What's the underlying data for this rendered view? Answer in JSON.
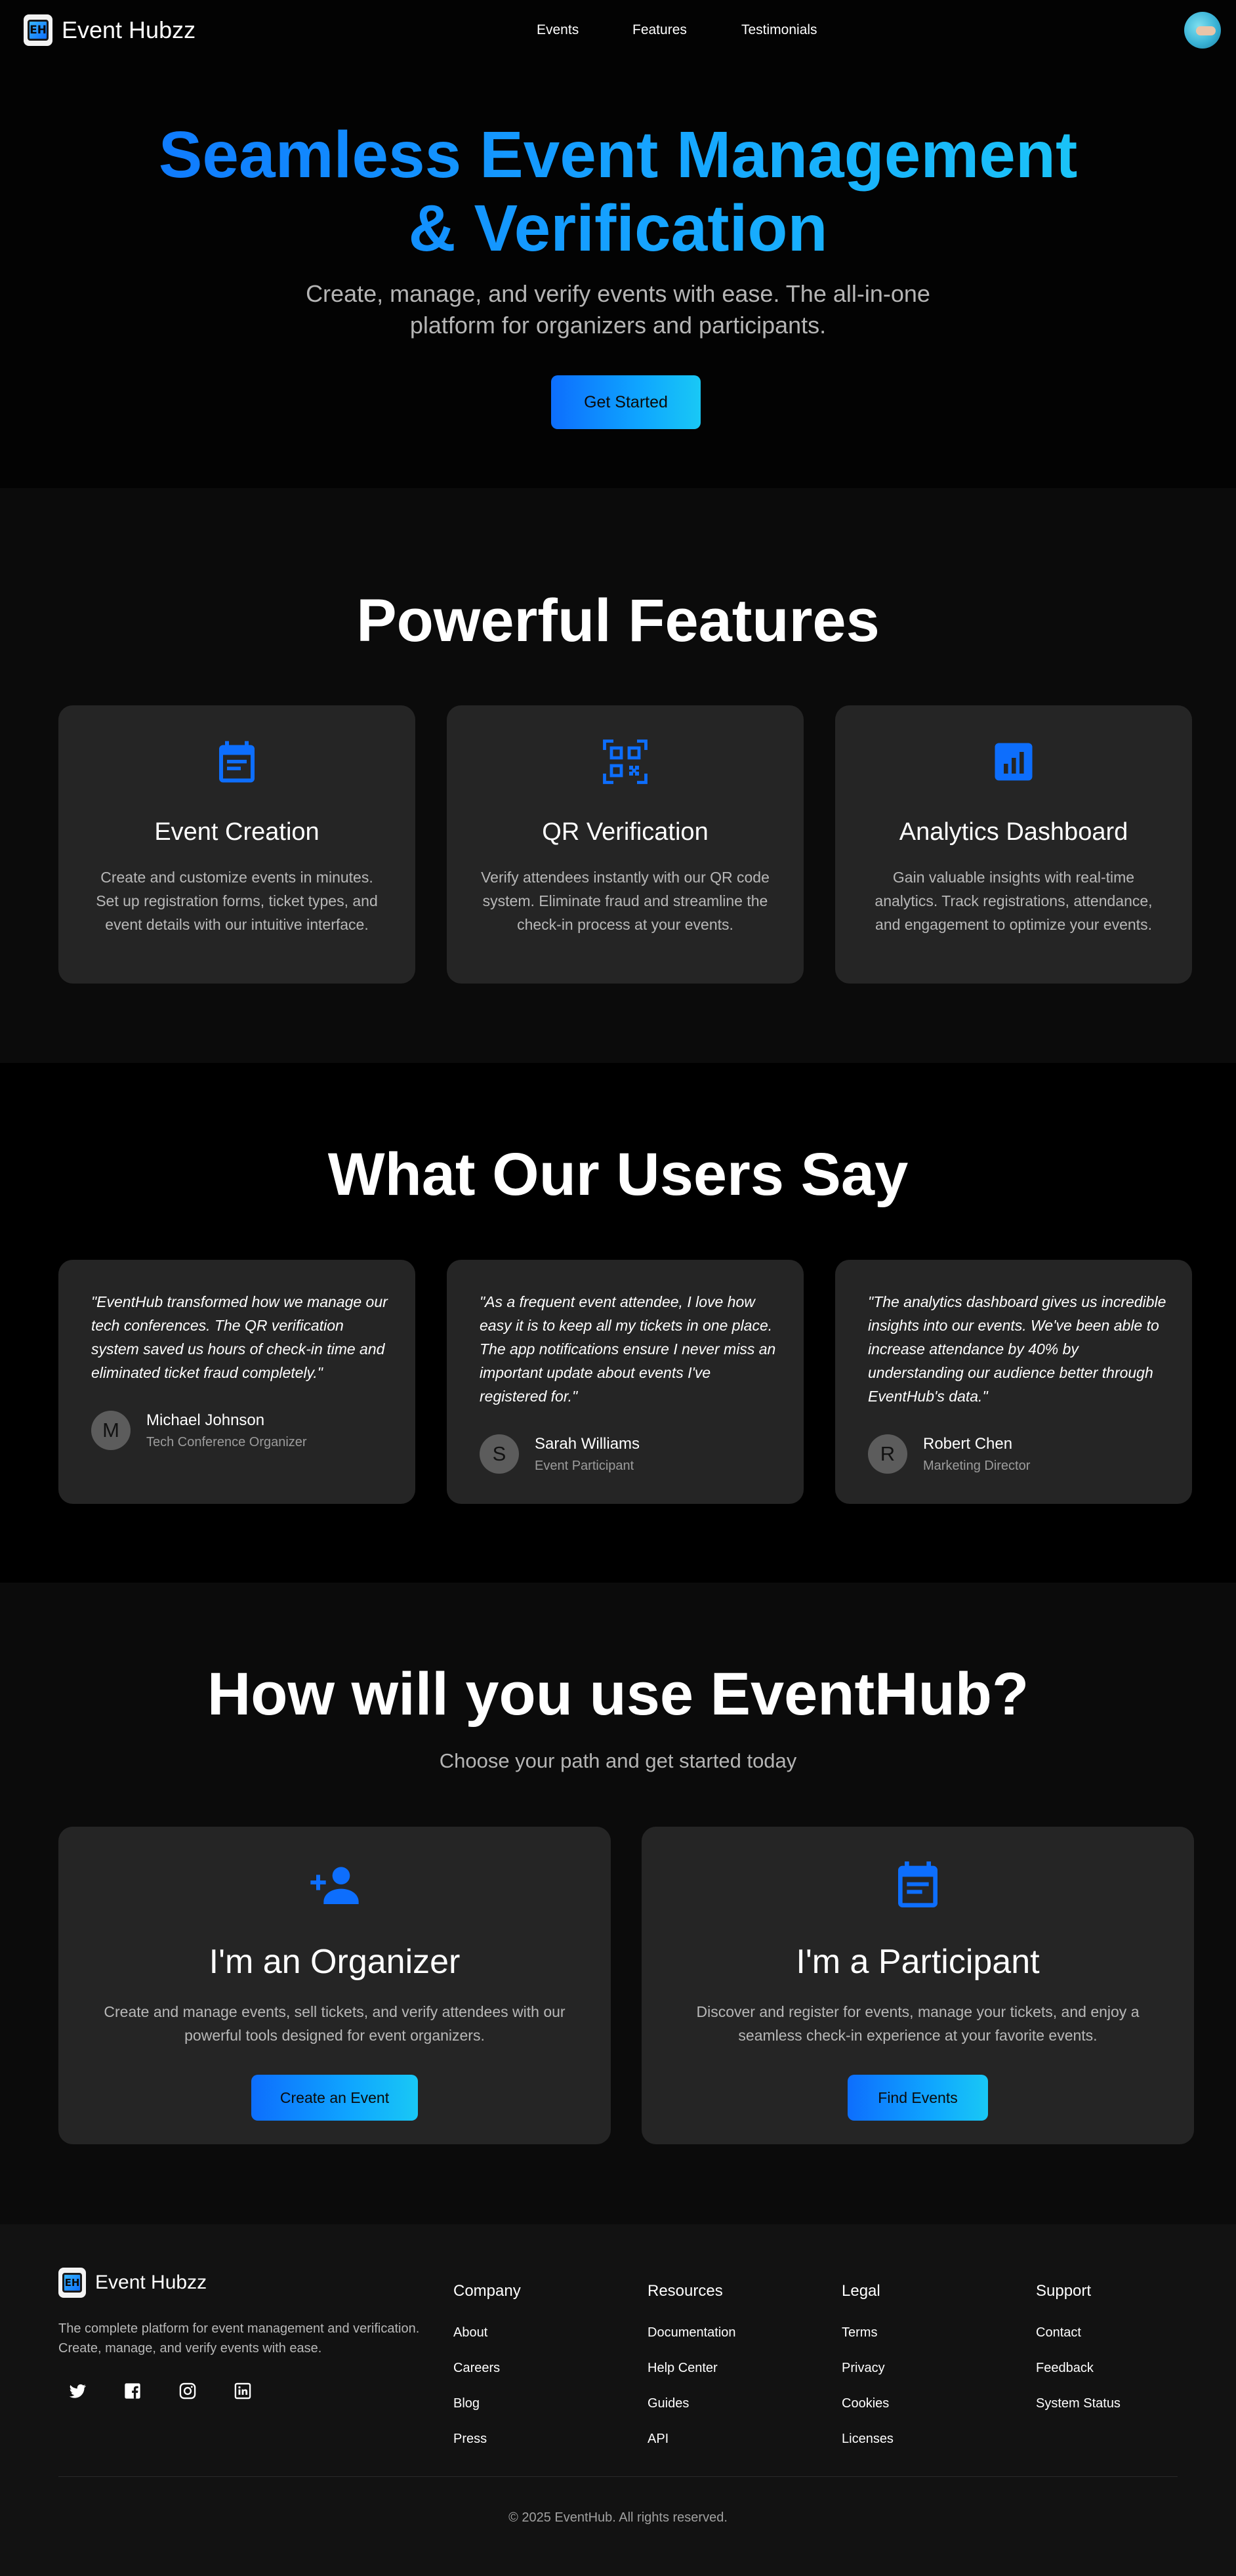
{
  "brand": {
    "name": "Event Hubzz",
    "logo_glyph": "EH",
    "accent": "#0d6efd",
    "accent_end": "#19c8f5"
  },
  "nav": {
    "links": [
      "Events",
      "Features",
      "Testimonials"
    ]
  },
  "hero": {
    "title_line1": "Seamless Event Management",
    "title_line2": "& Verification",
    "subtitle": "Create, manage, and verify events with ease. The all-in-one platform for organizers and participants.",
    "cta": "Get Started"
  },
  "features": {
    "title": "Powerful Features",
    "items": [
      {
        "icon": "calendar-icon",
        "title": "Event Creation",
        "desc": "Create and customize events in minutes. Set up registration forms, ticket types, and event details with our intuitive interface."
      },
      {
        "icon": "qr-code-icon",
        "title": "QR Verification",
        "desc": "Verify attendees instantly with our QR code system. Eliminate fraud and streamline the check-in process at your events."
      },
      {
        "icon": "analytics-icon",
        "title": "Analytics Dashboard",
        "desc": "Gain valuable insights with real-time analytics. Track registrations, attendance, and engagement to optimize your events."
      }
    ]
  },
  "testimonials": {
    "title": "What Our Users Say",
    "items": [
      {
        "quote": "\"EventHub transformed how we manage our tech conferences. The QR verification system saved us hours of check-in time and eliminated ticket fraud completely.\"",
        "initial": "M",
        "name": "Michael Johnson",
        "role": "Tech Conference Organizer"
      },
      {
        "quote": "\"As a frequent event attendee, I love how easy it is to keep all my tickets in one place. The app notifications ensure I never miss an important update about events I've registered for.\"",
        "initial": "S",
        "name": "Sarah Williams",
        "role": "Event Participant"
      },
      {
        "quote": "\"The analytics dashboard gives us incredible insights into our events. We've been able to increase attendance by 40% by understanding our audience better through EventHub's data.\"",
        "initial": "R",
        "name": "Robert Chen",
        "role": "Marketing Director"
      }
    ]
  },
  "use": {
    "title": "How will you use EventHub?",
    "subtitle": "Choose your path and get started today",
    "items": [
      {
        "icon": "add-user-icon",
        "title": "I'm an Organizer",
        "desc": "Create and manage events, sell tickets, and verify attendees with our powerful tools designed for event organizers.",
        "cta": "Create an Event"
      },
      {
        "icon": "calendar-icon",
        "title": "I'm a Participant",
        "desc": "Discover and register for events, manage your tickets, and enjoy a seamless check-in experience at your favorite events.",
        "cta": "Find Events"
      }
    ]
  },
  "footer": {
    "brand": "Event Hubzz",
    "desc": "The complete platform for event management and verification. Create, manage, and verify events with ease.",
    "socials": [
      "twitter-icon",
      "facebook-icon",
      "instagram-icon",
      "linkedin-icon"
    ],
    "columns": [
      {
        "title": "Company",
        "links": [
          "About",
          "Careers",
          "Blog",
          "Press"
        ]
      },
      {
        "title": "Resources",
        "links": [
          "Documentation",
          "Help Center",
          "Guides",
          "API"
        ]
      },
      {
        "title": "Legal",
        "links": [
          "Terms",
          "Privacy",
          "Cookies",
          "Licenses"
        ]
      },
      {
        "title": "Support",
        "links": [
          "Contact",
          "Feedback",
          "System Status"
        ]
      }
    ],
    "copyright": "© 2025 EventHub. All rights reserved."
  }
}
